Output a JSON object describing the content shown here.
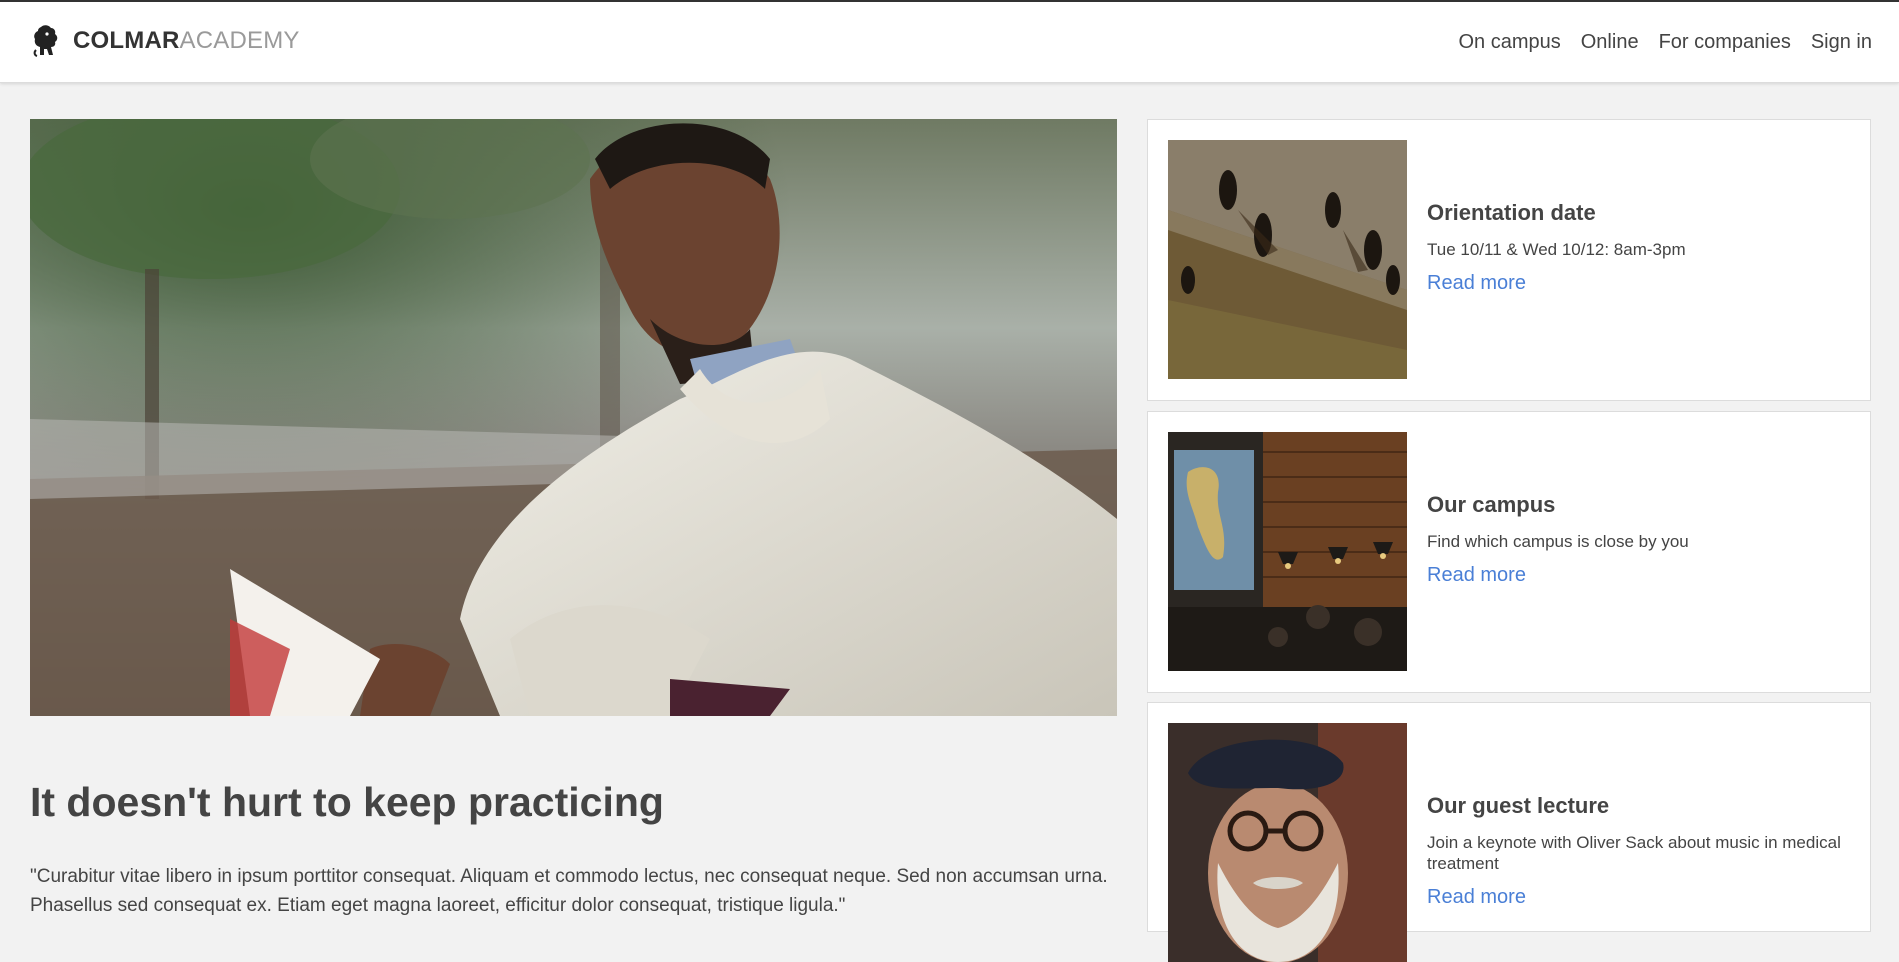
{
  "brand": {
    "name_bold": "COLMAR",
    "name_light": "ACADEMY",
    "logo_icon": "lion-logo-icon"
  },
  "nav": {
    "items": [
      {
        "label": "On campus"
      },
      {
        "label": "Online"
      },
      {
        "label": "For companies"
      },
      {
        "label": "Sign in"
      }
    ]
  },
  "hero": {
    "image": "man-reading-book-photo",
    "headline": "It doesn't hurt to keep practicing",
    "quote": "\"Curabitur vitae libero in ipsum porttitor consequat. Aliquam et commodo lectus, nec consequat neque. Sed non accumsan urna. Phasellus sed consequat ex. Etiam eget magna laoreet, efficitur dolor consequat, tristique ligula.\""
  },
  "cards": [
    {
      "image": "people-walking-aerial-photo",
      "title": "Orientation date",
      "text": "Tue 10/11 & Wed 10/12: 8am-3pm",
      "link": "Read more"
    },
    {
      "image": "campus-cafe-map-photo",
      "title": "Our campus",
      "text": "Find which campus is close by you",
      "link": "Read more"
    },
    {
      "image": "old-man-beret-photo",
      "title": "Our guest lecture",
      "text": "Join a keynote with Oliver Sack about music in medical treatment",
      "link": "Read more"
    }
  ],
  "colors": {
    "background": "#f2f2f2",
    "text": "#444444",
    "link": "#4a7fd6",
    "logo_light": "#9a9a9a"
  }
}
